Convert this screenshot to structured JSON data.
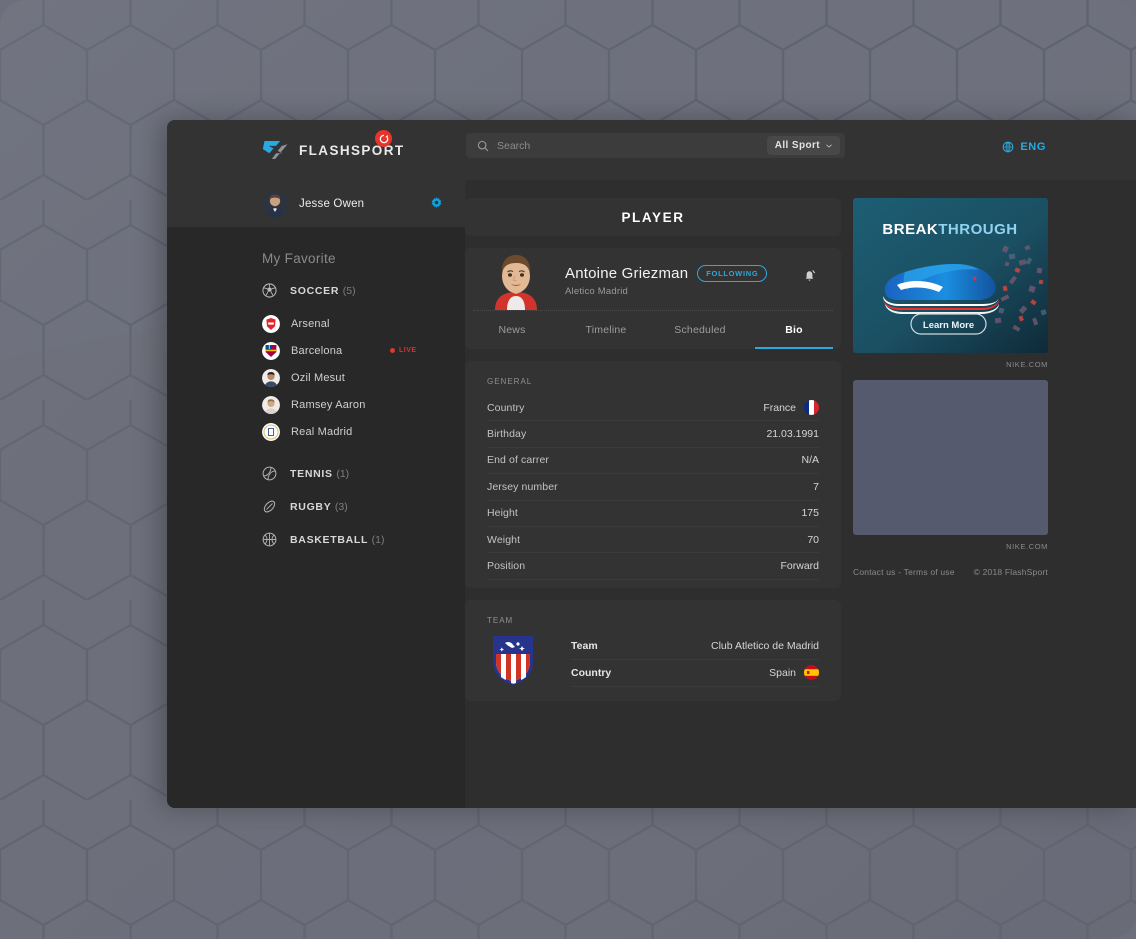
{
  "brand": {
    "name": "FLASHSPORT",
    "badge_icon": "refresh-icon",
    "logo_icon": "flashsport-logo"
  },
  "search": {
    "placeholder": "Search",
    "value": "",
    "icon": "search-icon"
  },
  "sport_filter": {
    "label": "All Sport",
    "icon": "chevron-down-icon"
  },
  "language": {
    "label": "ENG",
    "icon": "globe-icon"
  },
  "profile": {
    "name": "Jesse Owen",
    "settings_icon": "gear-icon",
    "avatar_icon": "user-avatar"
  },
  "sidebar": {
    "favorites_title": "My Favorite",
    "sports": [
      {
        "label": "SOCCER",
        "count": "(5)",
        "icon": "soccer-ball-icon"
      },
      {
        "label": "TENNIS",
        "count": "(1)",
        "icon": "tennis-ball-icon"
      },
      {
        "label": "RUGBY",
        "count": "(3)",
        "icon": "rugby-ball-icon"
      },
      {
        "label": "BASKETBALL",
        "count": "(1)",
        "icon": "basketball-icon"
      }
    ],
    "teams": [
      {
        "name": "Arsenal",
        "live": false,
        "icon": "arsenal-crest"
      },
      {
        "name": "Barcelona",
        "live": true,
        "live_label": "LIVE",
        "icon": "barcelona-crest"
      },
      {
        "name": "Ozil Mesut",
        "live": false,
        "icon": "player-avatar"
      },
      {
        "name": "Ramsey Aaron",
        "live": false,
        "icon": "player-avatar"
      },
      {
        "name": "Real Madrid",
        "live": false,
        "icon": "real-madrid-crest"
      }
    ]
  },
  "page": {
    "title": "PLAYER"
  },
  "player": {
    "name": "Antoine Griezman",
    "club": "Aletico Madrid",
    "following_label": "FOLLOWING",
    "bell_icon": "bell-muted-icon",
    "photo_icon": "player-headshot",
    "tabs": [
      {
        "label": "News",
        "active": false
      },
      {
        "label": "Timeline",
        "active": false
      },
      {
        "label": "Scheduled",
        "active": false
      },
      {
        "label": "Bio",
        "active": true
      }
    ]
  },
  "general": {
    "label": "GENERAL",
    "rows": [
      {
        "key": "Country",
        "value": "France",
        "flag": "flag-france"
      },
      {
        "key": "Birthday",
        "value": "21.03.1991",
        "flag": ""
      },
      {
        "key": "End of carrer",
        "value": "N/A",
        "flag": ""
      },
      {
        "key": "Jersey number",
        "value": "7",
        "flag": ""
      },
      {
        "key": "Height",
        "value": "175",
        "flag": ""
      },
      {
        "key": "Weight",
        "value": "70",
        "flag": ""
      },
      {
        "key": "Position",
        "value": "Forward",
        "flag": ""
      }
    ]
  },
  "team": {
    "label": "TEAM",
    "crest_icon": "atletico-madrid-crest",
    "rows": [
      {
        "key": "Team",
        "value": "Club Atletico de Madrid",
        "flag": ""
      },
      {
        "key": "Country",
        "value": "Spain",
        "flag": "flag-spain"
      }
    ]
  },
  "ads": {
    "primary": {
      "headline_strong": "BREAK",
      "headline_light": "THROUGH",
      "cta": "Learn More",
      "caption": "NIKE.COM"
    },
    "secondary": {
      "caption": "NIKE.COM"
    }
  },
  "footer": {
    "links": "Contact us - Terms of use",
    "copyright": "© 2018 FlashSport"
  },
  "colors": {
    "accent": "#2aa8e0",
    "live": "#e0362c",
    "window_bg": "#2e2e2e",
    "sidebar_bg": "#282828",
    "card_bg": "#333333",
    "page_bg": "#6e717d"
  }
}
